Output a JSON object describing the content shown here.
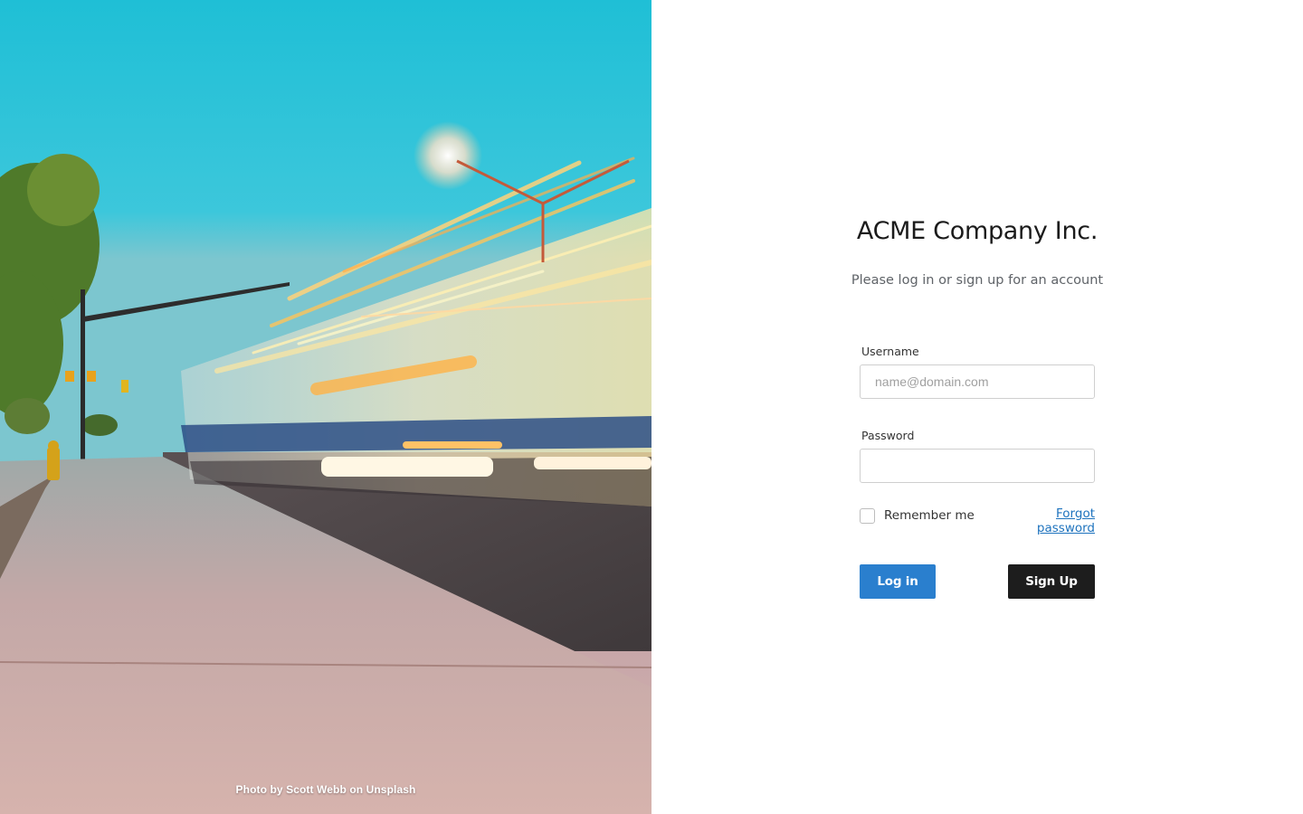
{
  "photo": {
    "credit": "Photo by Scott Webb on Unsplash"
  },
  "brand": {
    "title": "ACME Company Inc.",
    "subtitle": "Please log in or sign up for an account"
  },
  "form": {
    "username_label": "Username",
    "username_placeholder": "name@domain.com",
    "username_value": "",
    "password_label": "Password",
    "password_value": "",
    "remember_label": "Remember me",
    "remember_checked": false,
    "forgot_label": "Forgot password"
  },
  "buttons": {
    "login_label": "Log in",
    "signup_label": "Sign Up"
  },
  "colors": {
    "login_button": "#2a7fce",
    "signup_button": "#1d1d1d",
    "link": "#1e73be",
    "sky": "#2fc4d9"
  }
}
